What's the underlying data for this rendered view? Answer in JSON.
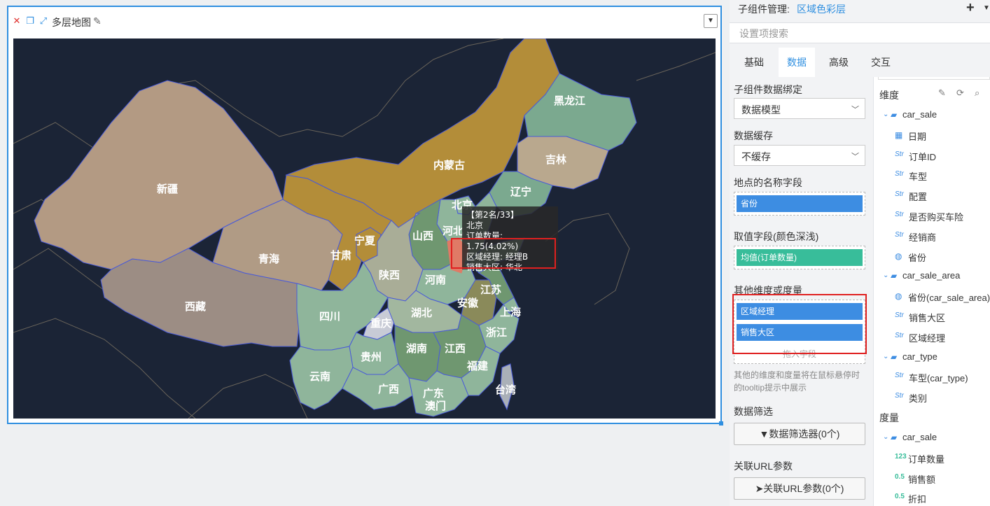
{
  "widget": {
    "title": "多层地图",
    "icons": [
      "close-icon",
      "copy-icon",
      "expand-icon",
      "pencil-icon",
      "chevron-down-icon"
    ]
  },
  "map": {
    "provinces": [
      "新疆",
      "西藏",
      "青海",
      "甘肃",
      "内蒙古",
      "黑龙江",
      "吉林",
      "辽宁",
      "北京",
      "河北",
      "山西",
      "宁夏",
      "陕西",
      "四川",
      "重庆",
      "湖北",
      "河南",
      "安徽",
      "江苏",
      "上海",
      "浙江",
      "湖南",
      "江西",
      "贵州",
      "云南",
      "广西",
      "广东",
      "澳门",
      "福建",
      "台湾"
    ],
    "tooltip": {
      "rank": "【第2名/33】",
      "name": "北京",
      "value": "订单数量: 1.75(4.02%)",
      "manager": "区域经理: 经理B",
      "region": "销售大区: 华北"
    }
  },
  "panel": {
    "header_label": "子组件管理:",
    "header_value": "区域色彩层",
    "search_placeholder": "设置项搜索",
    "tabs": [
      "基础",
      "数据",
      "高级",
      "交互"
    ],
    "active_tab": "数据",
    "data_binding_label": "子组件数据绑定",
    "data_binding_value": "数据模型",
    "cache_label": "数据缓存",
    "cache_value": "不缓存",
    "location_field_label": "地点的名称字段",
    "location_field_chip": "省份",
    "value_field_label": "取值字段(颜色深浅)",
    "value_field_chip": "均值(订单数量)",
    "other_label": "其他维度或度量",
    "other_chips": [
      "区域经理",
      "销售大区"
    ],
    "drop_hint": "拖入字段",
    "note": "其他的维度和度量将在鼠标悬停时的tooltip提示中展示",
    "filter_label": "数据筛选",
    "filter_button": "数据筛选器(0个)",
    "url_label": "关联URL参数",
    "url_button": "关联URL参数(0个)"
  },
  "tree": {
    "dim_header": "维度",
    "measure_header": "度量",
    "dimensions": [
      {
        "type": "folder",
        "label": "car_sale"
      },
      {
        "type": "date",
        "label": "日期"
      },
      {
        "type": "str",
        "label": "订单ID"
      },
      {
        "type": "str",
        "label": "车型"
      },
      {
        "type": "str",
        "label": "配置"
      },
      {
        "type": "str",
        "label": "是否购买车险"
      },
      {
        "type": "str",
        "label": "经销商"
      },
      {
        "type": "geo",
        "label": "省份"
      },
      {
        "type": "folder",
        "label": "car_sale_area"
      },
      {
        "type": "geo",
        "label": "省份(car_sale_area)"
      },
      {
        "type": "str",
        "label": "销售大区"
      },
      {
        "type": "str",
        "label": "区域经理"
      },
      {
        "type": "folder",
        "label": "car_type"
      },
      {
        "type": "str",
        "label": "车型(car_type)"
      },
      {
        "type": "str",
        "label": "类别"
      }
    ],
    "measures": [
      {
        "type": "folder",
        "label": "car_sale"
      },
      {
        "type": "int",
        "label": "订单数量"
      },
      {
        "type": "float",
        "label": "销售额"
      },
      {
        "type": "float",
        "label": "折扣"
      }
    ],
    "type_glyphs": {
      "str": "Str",
      "int": "123",
      "float": "0.5"
    }
  },
  "colors": {
    "accent": "#2f8fe0",
    "map_background": "#1b2436",
    "chip_blue": "#3d8de2",
    "chip_green": "#38bd9a",
    "highlight_red": "#e02020"
  }
}
